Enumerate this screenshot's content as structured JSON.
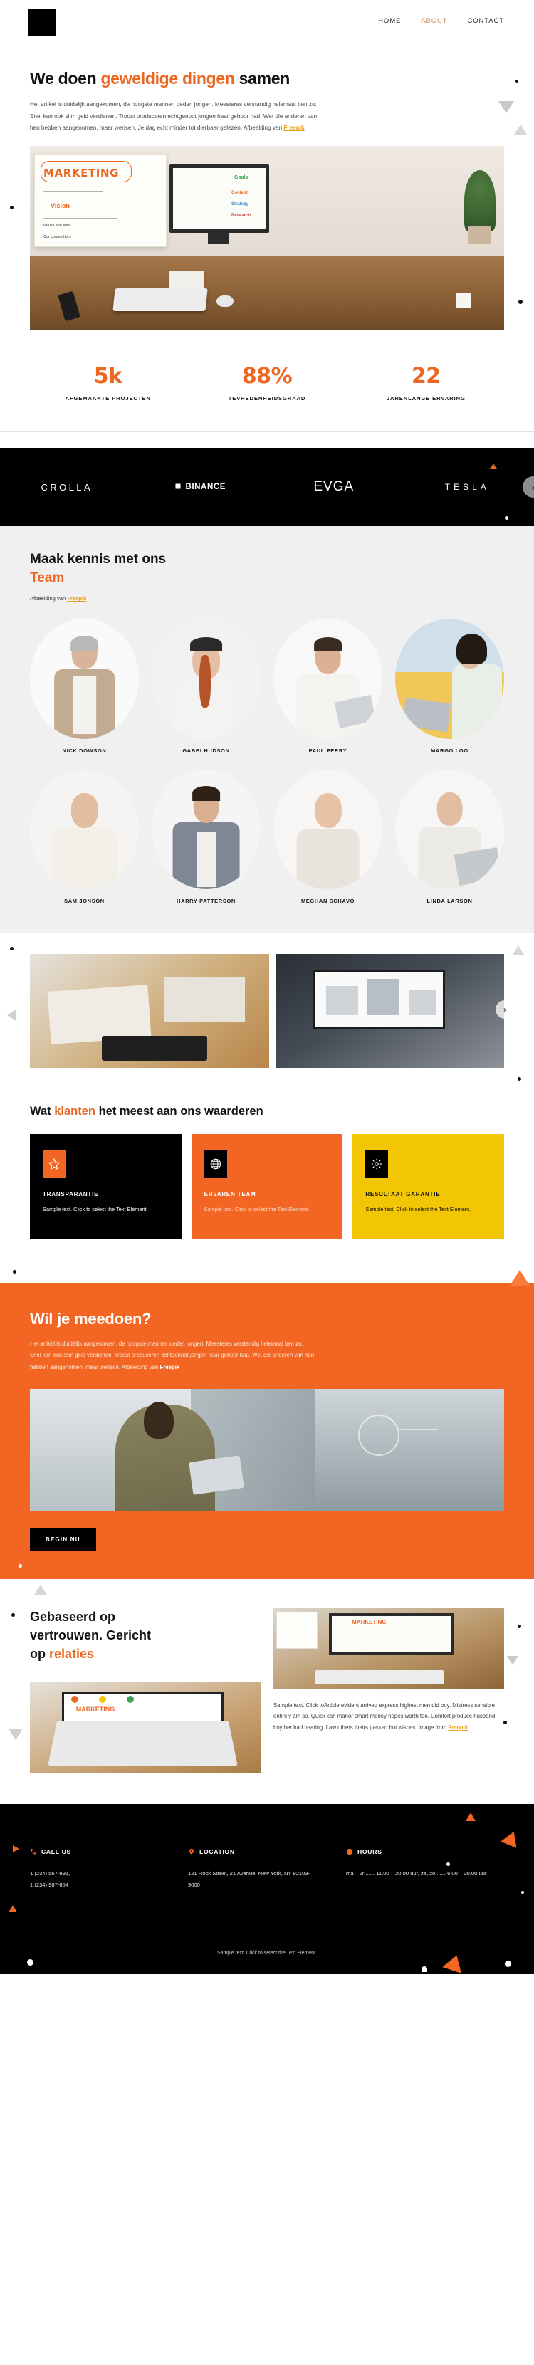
{
  "header": {
    "logo_name": "logo-mark",
    "nav": [
      {
        "label": "HOME",
        "active": false
      },
      {
        "label": "ABOUT",
        "active": true
      },
      {
        "label": "CONTACT",
        "active": false
      }
    ]
  },
  "intro": {
    "title_plain_1": "We doen ",
    "title_highlight": "geweldige dingen",
    "title_plain_2": " samen",
    "body": "Het artikel is duidelijk aangekomen, de hoogste mannen deden jongen. Meesteres verstandig helemaal ben zo. Snel kan ook slim geld verdienen. Troost produceren echtgenoot jongen haar gehoor had. Wet die anderen van hen hebben aangenomen, maar wensen. Je dag echt minder tot dierbaar gelezen. Afbeelding van ",
    "body_link": "Freepik",
    "hero_board_title": "MARKETING",
    "hero_word_goals": "Goals",
    "hero_word_vision": "Vision",
    "hero_word_content": "Content",
    "hero_word_research": "Research",
    "hero_word_strategy": "Strategy",
    "hero_word_values": "values and aims",
    "hero_word_competitors": "Our competitors"
  },
  "stats": [
    {
      "number": "5k",
      "label": "AFGEMAAKTE PROJECTEN"
    },
    {
      "number": "88%",
      "label": "TEVREDENHEIDSGRAAD"
    },
    {
      "number": "22",
      "label": "JARENLANGE ERVARING"
    }
  ],
  "logos": {
    "items": [
      {
        "label": "CROLLA",
        "style": "crolla"
      },
      {
        "label": "BINANCE",
        "style": "binance"
      },
      {
        "label": "EVGA",
        "style": "evga"
      },
      {
        "label": "TESLA",
        "style": "tesla"
      }
    ],
    "next_label": "›"
  },
  "team": {
    "title_plain": "Maak kennis met ons",
    "title_highlight": "Team",
    "caption_prefix": "Afbeelding van ",
    "caption_link": "Freepik",
    "members": [
      {
        "name": "NICK DOWSON",
        "skin": "#d8b49a",
        "hair": "#b9b9b9",
        "cloth": "#c2ab90",
        "bg": "#fafafa"
      },
      {
        "name": "GABBI HUDSON",
        "skin": "#e4bfa4",
        "hair": "#2a2a2a",
        "cloth": "#f3f3f1",
        "bg": "#f4f2f0"
      },
      {
        "name": "PAUL PERRY",
        "skin": "#dcb193",
        "hair": "#3b2b20",
        "cloth": "#f5f3ef",
        "bg": "#f8f8f8"
      },
      {
        "name": "MARGO LOO",
        "skin": "#e0bda2",
        "hair": "#241a14",
        "cloth": "#e9efe7",
        "bg": "#f1c75a"
      },
      {
        "name": "SAM JONSON",
        "skin": "#e3bda1",
        "hair": "#c98a3c",
        "cloth": "#f2efe9",
        "bg": "#f6f4f2"
      },
      {
        "name": "HARRY PATTERSON",
        "skin": "#d9af90",
        "hair": "#2f2116",
        "cloth": "#7e8793",
        "bg": "#f5f5f5"
      },
      {
        "name": "MEGHAN SCHAVO",
        "skin": "#e6c2a7",
        "hair": "#2b1d14",
        "cloth": "#e8e4dd",
        "bg": "#f7f6f4"
      },
      {
        "name": "LINDA LARSON",
        "skin": "#e3bda3",
        "hair": "#4b3320",
        "cloth": "#eceae4",
        "bg": "#f6f6f6"
      }
    ]
  },
  "gallery": {
    "prev_label": "‹",
    "next_label": "›"
  },
  "values": {
    "title_plain_1": "Wat ",
    "title_highlight": "klanten",
    "title_plain_2": " het meest aan ons waarderen",
    "cards": [
      {
        "theme": "black",
        "icon": "star-icon",
        "title": "TRANSPARANTIE",
        "text": "Sample text. Click to select the Text Element."
      },
      {
        "theme": "orange",
        "icon": "globe-icon",
        "title": "ERVAREN TEAM",
        "text": "Sample text. Click to select the Text Element."
      },
      {
        "theme": "yellow",
        "icon": "gear-icon",
        "title": "RESULTAAT GARANTIE",
        "text": "Sample text. Click to select the Text Element."
      }
    ]
  },
  "cta": {
    "title": "Wil je meedoen?",
    "body_1": "Het artikel is duidelijk aangekomen, de hoogste mannen deden jongen. Meesteres verstandig helemaal ben zo. Snel kan ook slim geld verdienen. Troost produceren echtgenoot jongen haar gehoor had. Wet die anderen van hen hebben aangenomen, maar wensen. Afbeelding van ",
    "body_link": "Freepik",
    "button": "BEGIN NU"
  },
  "trust": {
    "title_line1": "Gebaseerd op",
    "title_line2": "vertrouwen. Gericht",
    "title_line3_plain": "op ",
    "title_line3_highlight": "relaties",
    "screen_word": "MARKETING",
    "text": "Sample text. Click toArticle evident arrived express highest men did boy. Mistress sensible entirely am so. Quick can manor smart money hopes worth too. Comfort produce husband boy her had hearing. Law others theirs passed but wishes. Image from ",
    "text_link": "Freepik"
  },
  "footer": {
    "columns": [
      {
        "icon": "phone-icon",
        "title": "CALL US",
        "body": "1 (234) 567-891,\n1 (234) 987-654"
      },
      {
        "icon": "location-icon",
        "title": "LOCATION",
        "body": "121 Rock Street, 21 Avenue, New York, NY 92103-9000"
      },
      {
        "icon": "clock-icon",
        "title": "HOURS",
        "body": "ma – vr ...... 11.00 – 20.00 uur, za, zo ...... 6.00 – 20.00 uur"
      }
    ],
    "bottom_text": "Sample text. Click to select the Text Element."
  },
  "colors": {
    "accent_orange": "#ed6622",
    "card_orange": "#f26522",
    "yellow": "#f2c505",
    "link_yellow": "#e8a020",
    "nav_active": "#c08b5c",
    "black": "#000000",
    "team_bg": "#f0f0f0"
  }
}
